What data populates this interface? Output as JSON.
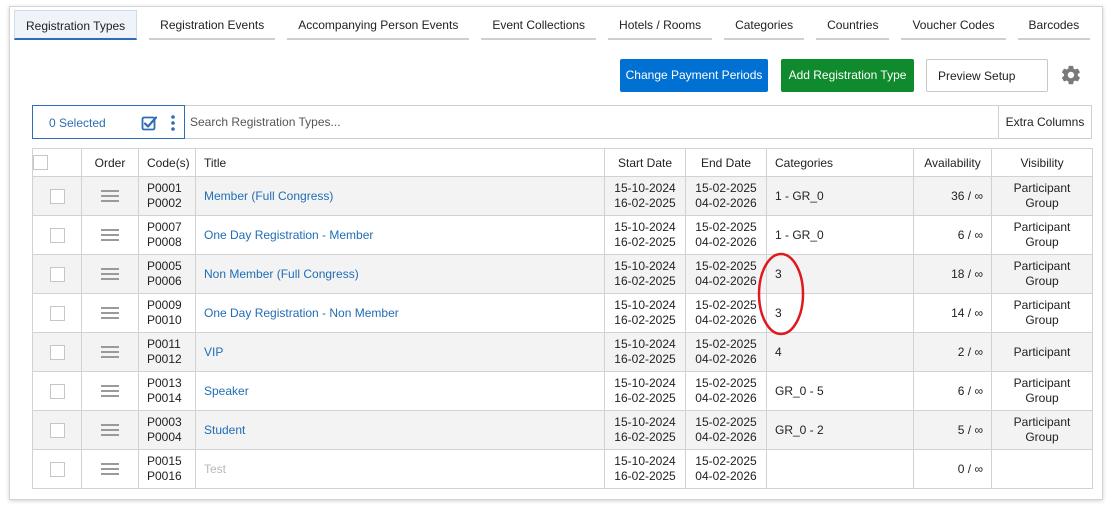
{
  "tabs": [
    {
      "label": "Registration Types",
      "active": true
    },
    {
      "label": "Registration Events",
      "active": false
    },
    {
      "label": "Accompanying Person Events",
      "active": false
    },
    {
      "label": "Event Collections",
      "active": false
    },
    {
      "label": "Hotels / Rooms",
      "active": false
    },
    {
      "label": "Categories",
      "active": false
    },
    {
      "label": "Countries",
      "active": false
    },
    {
      "label": "Voucher Codes",
      "active": false
    },
    {
      "label": "Barcodes",
      "active": false
    }
  ],
  "actions": {
    "change_payment_periods": "Change Payment Periods",
    "add_registration_type": "Add Registration Type",
    "preview_setup": "Preview Setup"
  },
  "toolbar": {
    "selected_label": "0 Selected",
    "search_placeholder": "Search Registration Types...",
    "extra_columns": "Extra Columns"
  },
  "table": {
    "headers": {
      "order": "Order",
      "codes": "Code(s)",
      "title": "Title",
      "start_date": "Start Date",
      "end_date": "End Date",
      "categories": "Categories",
      "availability": "Availability",
      "visibility": "Visibility"
    },
    "rows": [
      {
        "code1": "P0001",
        "code2": "P0002",
        "title": "Member (Full Congress)",
        "start1": "15-10-2024",
        "start2": "16-02-2025",
        "end1": "15-02-2025",
        "end2": "04-02-2026",
        "categories": "1 - GR_0",
        "availability": "36 / ∞",
        "vis1": "Participant",
        "vis2": "Group"
      },
      {
        "code1": "P0007",
        "code2": "P0008",
        "title": "One Day Registration - Member",
        "start1": "15-10-2024",
        "start2": "16-02-2025",
        "end1": "15-02-2025",
        "end2": "04-02-2026",
        "categories": "1 - GR_0",
        "availability": "6 / ∞",
        "vis1": "Participant",
        "vis2": "Group"
      },
      {
        "code1": "P0005",
        "code2": "P0006",
        "title": "Non Member (Full Congress)",
        "start1": "15-10-2024",
        "start2": "16-02-2025",
        "end1": "15-02-2025",
        "end2": "04-02-2026",
        "categories": "3",
        "availability": "18 / ∞",
        "vis1": "Participant",
        "vis2": "Group"
      },
      {
        "code1": "P0009",
        "code2": "P0010",
        "title": "One Day Registration - Non Member",
        "start1": "15-10-2024",
        "start2": "16-02-2025",
        "end1": "15-02-2025",
        "end2": "04-02-2026",
        "categories": "3",
        "availability": "14 / ∞",
        "vis1": "Participant",
        "vis2": "Group"
      },
      {
        "code1": "P0011",
        "code2": "P0012",
        "title": "VIP",
        "start1": "15-10-2024",
        "start2": "16-02-2025",
        "end1": "15-02-2025",
        "end2": "04-02-2026",
        "categories": "4",
        "availability": "2 / ∞",
        "vis1": "Participant",
        "vis2": ""
      },
      {
        "code1": "P0013",
        "code2": "P0014",
        "title": "Speaker",
        "start1": "15-10-2024",
        "start2": "16-02-2025",
        "end1": "15-02-2025",
        "end2": "04-02-2026",
        "categories": "GR_0 - 5",
        "availability": "6 / ∞",
        "vis1": "Participant",
        "vis2": "Group"
      },
      {
        "code1": "P0003",
        "code2": "P0004",
        "title": "Student",
        "start1": "15-10-2024",
        "start2": "16-02-2025",
        "end1": "15-02-2025",
        "end2": "04-02-2026",
        "categories": "GR_0 - 2",
        "availability": "5 / ∞",
        "vis1": "Participant",
        "vis2": "Group"
      },
      {
        "code1": "P0015",
        "code2": "P0016",
        "title": "Test",
        "start1": "15-10-2024",
        "start2": "16-02-2025",
        "end1": "15-02-2025",
        "end2": "04-02-2026",
        "categories": "",
        "availability": "0 / ∞",
        "vis1": "",
        "vis2": ""
      }
    ]
  },
  "colors": {
    "primary_blue": "#0070d2",
    "success_green": "#0f8a2d",
    "link_blue": "#1f6db5",
    "annotation_red": "#e0191e"
  },
  "icons": {
    "settings": "gear-icon",
    "select_all": "checkbox-check-icon",
    "more": "kebab-menu-icon",
    "drag_handle": "drag-handle-icon"
  }
}
